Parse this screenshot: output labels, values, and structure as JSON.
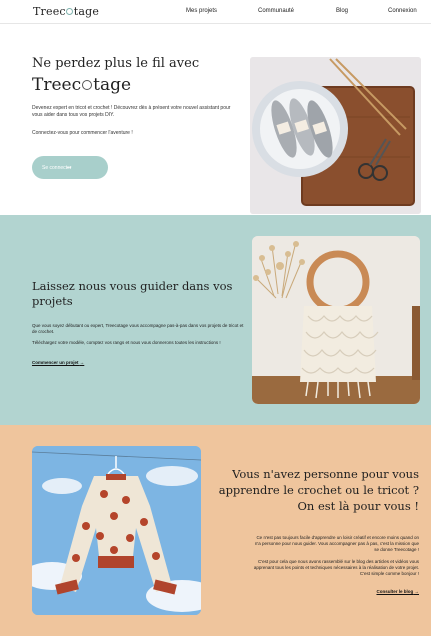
{
  "nav": {
    "logo": {
      "before": "Treec",
      "after": "tage"
    },
    "links": [
      "Mes projets",
      "Communauté",
      "Blog",
      "Connexion"
    ]
  },
  "hero": {
    "title": "Ne perdez plus le fil avec",
    "brand": {
      "before": "Treec",
      "after": "tage"
    },
    "paragraph1": "Devenez expert en tricot et crochet ! Découvrez dès à présent votre nouvel assistant pour vous aider dans tous vos projets DIY.",
    "paragraph2": "Connectez-vous pour commencer l'aventure !",
    "button_label": "Se connecter",
    "button_arrow": "→"
  },
  "guide": {
    "title": "Laissez nous vous guider dans vos projets",
    "paragraph1": "Que vous soyez débutant ou expert, Treecotage vous accompagne pas-à-pas dans vos projets de tricot et de crochet.",
    "paragraph2": "Téléchargez votre modèle, comptez vos rangs et nous vous donnerons toutes les instructions !",
    "link_label": "Commencer un projet",
    "link_arrow": "→"
  },
  "blog": {
    "title": "Vous n'avez personne pour vous apprendre le crochet ou le tricot ? On est là pour vous !",
    "paragraph1": "Ce n'est pas toujours facile d'apprendre un loisir créatif et encore moins quand on n'a personne pour nous guider. Vous accompagner pas à pas, c'est la mission que se donne Treecotage !",
    "paragraph2": "C'est pour cela que nous avons rassemblé sur le blog des articles et vidéos vous apprenant tous les points et techniques nécessaires à la réalisation de votre projet. C'est simple comme bonjour !",
    "link_label": "Consulter le blog",
    "link_arrow": "→"
  },
  "colors": {
    "teal_section": "#b2d4d0",
    "button": "#a8cfcb",
    "peach_section": "#efc59d"
  }
}
